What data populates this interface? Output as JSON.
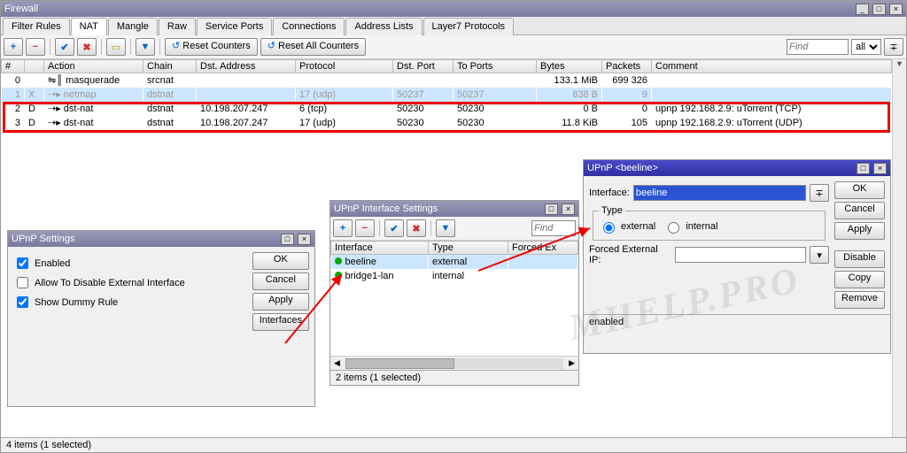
{
  "main": {
    "title": "Firewall",
    "tabs": [
      "Filter Rules",
      "NAT",
      "Mangle",
      "Raw",
      "Service Ports",
      "Connections",
      "Address Lists",
      "Layer7 Protocols"
    ],
    "active_tab": 1,
    "toolbar": {
      "reset_counters": "Reset Counters",
      "reset_all": "Reset All Counters",
      "find_placeholder": "Find",
      "filter": "all"
    },
    "columns": [
      "#",
      "",
      "Action",
      "Chain",
      "Dst. Address",
      "Protocol",
      "Dst. Port",
      "To Ports",
      "Bytes",
      "Packets",
      "Comment"
    ],
    "rows": [
      {
        "n": "0",
        "f": "",
        "action": "⇋║ masquerade",
        "chain": "srcnat",
        "dst": "",
        "proto": "",
        "dport": "",
        "tport": "",
        "bytes": "133.1 MiB",
        "packets": "699 326",
        "comment": ""
      },
      {
        "n": "1",
        "f": "X",
        "action": "⇢▸ netmap",
        "chain": "dstnat",
        "dst": "",
        "proto": "17 (udp)",
        "dport": "50237",
        "tport": "50237",
        "bytes": "838 B",
        "packets": "9",
        "comment": "",
        "sel": true,
        "disabled": true
      },
      {
        "n": "2",
        "f": "D",
        "action": "⇢▸ dst-nat",
        "chain": "dstnat",
        "dst": "10.198.207.247",
        "proto": "6 (tcp)",
        "dport": "50230",
        "tport": "50230",
        "bytes": "0 B",
        "packets": "0",
        "comment": "upnp 192.168.2.9: uTorrent (TCP)"
      },
      {
        "n": "3",
        "f": "D",
        "action": "⇢▸ dst-nat",
        "chain": "dstnat",
        "dst": "10.198.207.247",
        "proto": "17 (udp)",
        "dport": "50230",
        "tport": "50230",
        "bytes": "11.8 KiB",
        "packets": "105",
        "comment": "upnp 192.168.2.9: uTorrent (UDP)"
      }
    ],
    "status": "4 items (1 selected)"
  },
  "upnp_settings": {
    "title": "UPnP Settings",
    "enabled": "Enabled",
    "allow_disable": "Allow To Disable External Interface",
    "show_dummy": "Show Dummy Rule",
    "ok": "OK",
    "cancel": "Cancel",
    "apply": "Apply",
    "interfaces": "Interfaces"
  },
  "upnp_if": {
    "title": "UPnP Interface Settings",
    "find": "Find",
    "cols": [
      "Interface",
      "Type",
      "Forced Ex"
    ],
    "rows": [
      {
        "name": "beeline",
        "type": "external",
        "sel": true
      },
      {
        "name": "bridge1-lan",
        "type": "internal"
      }
    ],
    "status": "2 items (1 selected)"
  },
  "upnp_detail": {
    "title": "UPnP <beeline>",
    "interface_label": "Interface:",
    "interface_value": "beeline",
    "type_legend": "Type",
    "external": "external",
    "internal": "internal",
    "forced_ip_label": "Forced External IP:",
    "forced_ip_value": "",
    "ok": "OK",
    "cancel": "Cancel",
    "apply": "Apply",
    "disable": "Disable",
    "copy": "Copy",
    "remove": "Remove",
    "status": "enabled"
  },
  "wm": "MHELP.PRO"
}
